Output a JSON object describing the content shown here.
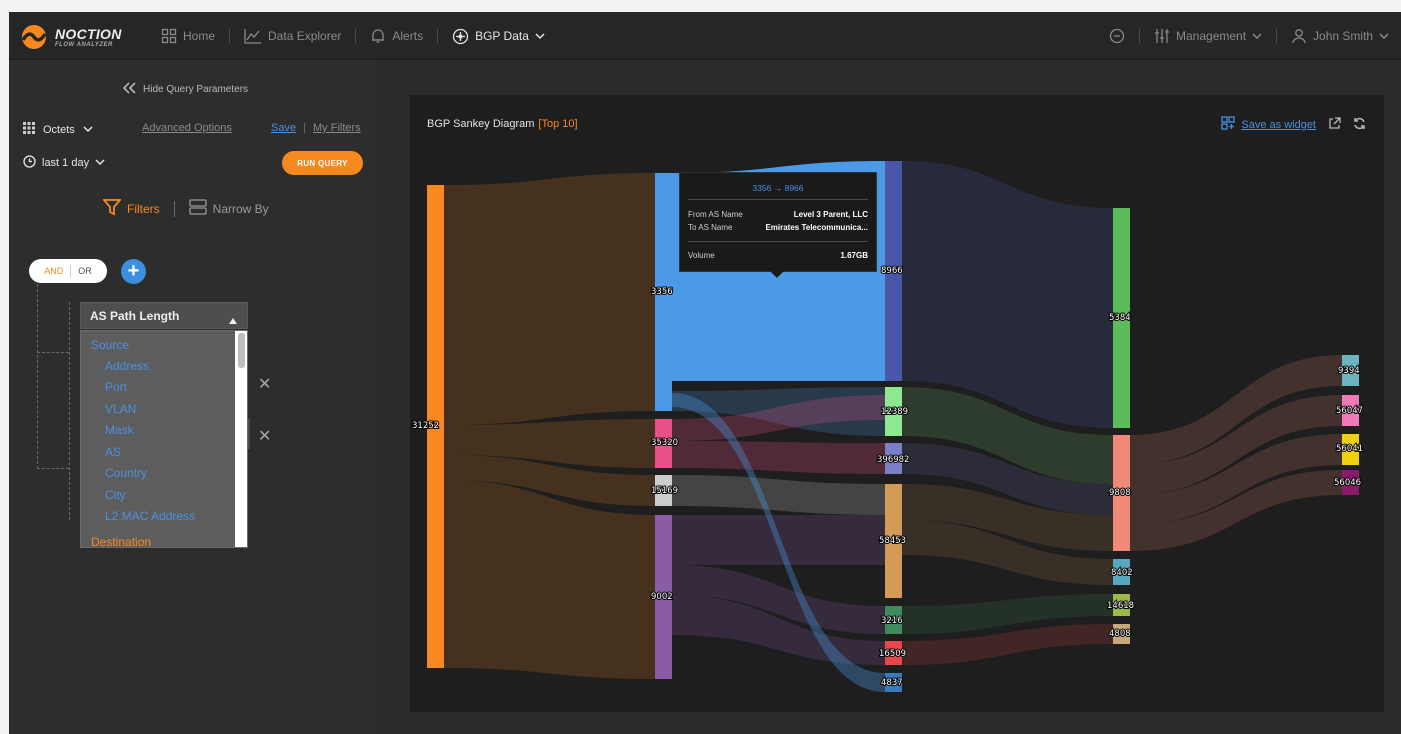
{
  "app": {
    "logo_name": "NOCTION",
    "logo_sub": "FLOW ANALYZER"
  },
  "nav": {
    "home": "Home",
    "data_explorer": "Data Explorer",
    "alerts": "Alerts",
    "bgp_data": "BGP Data",
    "management": "Management",
    "user": "John Smith"
  },
  "sidebar": {
    "hide_query": "Hide Query Parameters",
    "metric": "Octets",
    "advanced": "Advanced Options",
    "save": "Save",
    "my_filters": "My Filters",
    "period": "last 1 day",
    "run_query": "RUN QUERY",
    "filters": "Filters",
    "narrow_by": "Narrow By",
    "and_label": "AND",
    "or_label": "OR",
    "dropdown_value": "AS Path Length",
    "dropdown_items": [
      "Source",
      "Address",
      "Port",
      "VLAN",
      "Mask",
      "AS",
      "Country",
      "City",
      "L2 MAC Address",
      "Destination"
    ]
  },
  "card": {
    "title": "BGP Sankey Diagram",
    "top": "[Top 10]",
    "save_widget": "Save as widget"
  },
  "tooltip": {
    "title": "3356 → 8966",
    "from_label": "From AS Name",
    "from_value": "Level 3 Parent, LLC",
    "to_label": "To AS Name",
    "to_value": "Emirates Telecommunica...",
    "volume_label": "Volume",
    "volume_value": "1.67GB"
  },
  "colors": {
    "accent": "#f7891f",
    "link_blue": "#4a90e2"
  },
  "sankey": {
    "nodes": [
      {
        "id": "31252",
        "color": "#f7891f"
      },
      {
        "id": "3356",
        "color": "#4a9ae8"
      },
      {
        "id": "35320",
        "color": "#e8508a"
      },
      {
        "id": "15169",
        "color": "#cccccc"
      },
      {
        "id": "9002",
        "color": "#8a5ca8"
      },
      {
        "id": "8966",
        "color": "#4a56a8"
      },
      {
        "id": "12389",
        "color": "#8ee890"
      },
      {
        "id": "396982",
        "color": "#7a80c8"
      },
      {
        "id": "58453",
        "color": "#d39a58"
      },
      {
        "id": "3216",
        "color": "#3e8a5c"
      },
      {
        "id": "16509",
        "color": "#e8484a"
      },
      {
        "id": "4837",
        "color": "#3a7ab8"
      },
      {
        "id": "5384",
        "color": "#5cbc5a"
      },
      {
        "id": "9808",
        "color": "#f08a78"
      },
      {
        "id": "8402",
        "color": "#56a8c0"
      },
      {
        "id": "14618",
        "color": "#9aba4a"
      },
      {
        "id": "4808",
        "color": "#c8a878"
      },
      {
        "id": "9394",
        "color": "#6ab4c0"
      },
      {
        "id": "56047",
        "color": "#f07ab8"
      },
      {
        "id": "56041",
        "color": "#f0d010"
      },
      {
        "id": "56046",
        "color": "#8a1a6a"
      }
    ]
  }
}
